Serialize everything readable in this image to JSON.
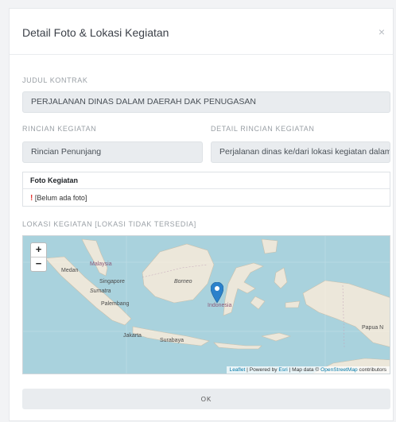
{
  "modal": {
    "title": "Detail Foto & Lokasi Kegiatan",
    "close_label": "×"
  },
  "judul_kontrak": {
    "label": "JUDUL KONTRAK",
    "value": "PERJALANAN DINAS DALAM DAERAH DAK PENUGASAN"
  },
  "rincian_kegiatan": {
    "label": "RINCIAN KEGIATAN",
    "value": "Rincian Penunjang"
  },
  "detail_rincian": {
    "label": "DETAIL RINCIAN KEGIATAN",
    "value": "Perjalanan dinas ke/dari lokasi kegiatan dalam"
  },
  "foto": {
    "header": "Foto Kegiatan",
    "alert_icon": "!",
    "status": "[Belum ada foto]"
  },
  "lokasi": {
    "label": "LOKASI KEGIATAN [LOKASI TIDAK TERSEDIA]"
  },
  "map": {
    "zoom_in": "+",
    "zoom_out": "−",
    "place_labels": {
      "medan": "Medan",
      "malaysia": "Malaysia",
      "singapore": "Singapore",
      "sumatra": "Sumatra",
      "borneo": "Borneo",
      "palembang": "Palembang",
      "indonesia": "Indonesia",
      "jakarta": "Jakarta",
      "surabaya": "Surabaya",
      "papua": "Papua N"
    },
    "attribution": {
      "leaflet": "Leaflet",
      "powered_by": " | Powered by ",
      "esri": "Esri",
      "map_data": " | Map data © ",
      "osm": "OpenStreetMap",
      "contributors": " contributors"
    },
    "marker_icon": "map-marker-icon"
  },
  "ok_button": "OK",
  "colors": {
    "water": "#a9d2dd",
    "land": "#ece7da",
    "marker": "#2a81cb",
    "alert": "#e3342f"
  }
}
